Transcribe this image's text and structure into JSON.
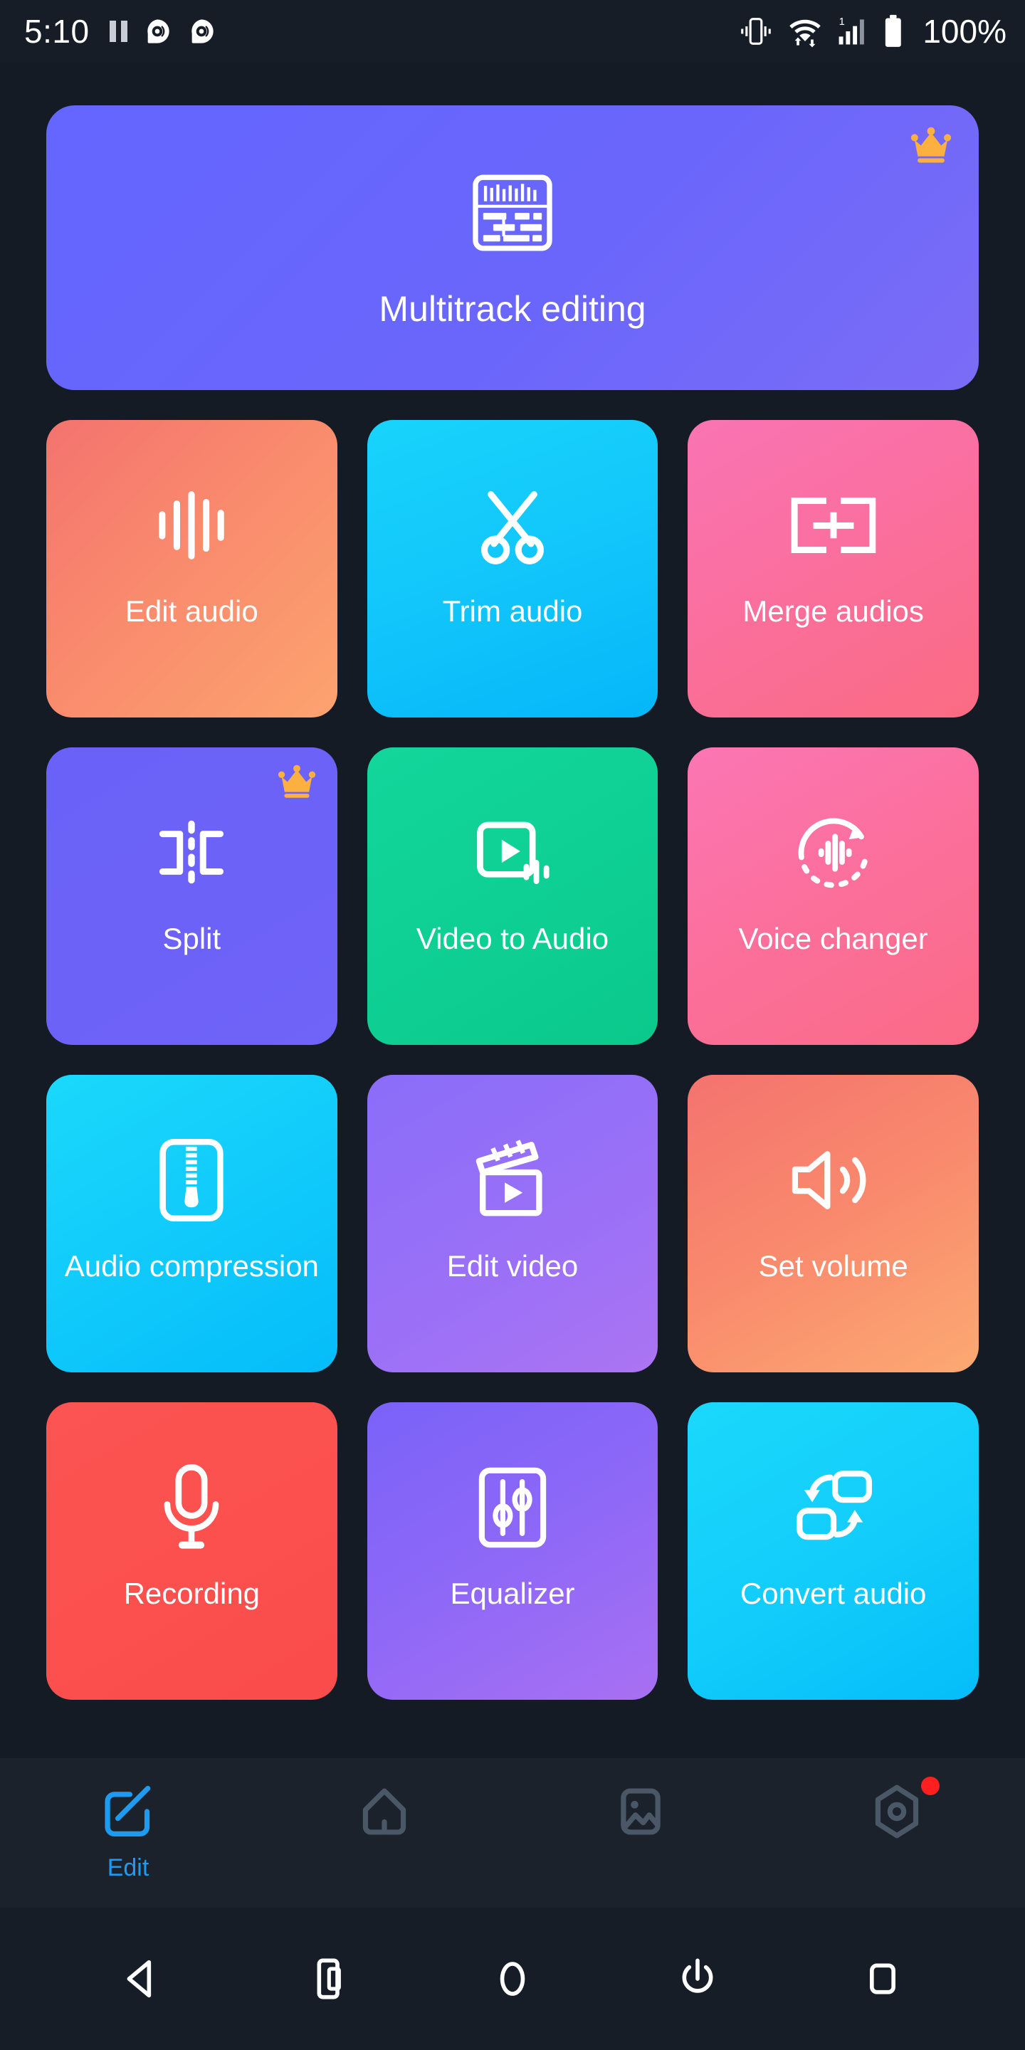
{
  "status_bar": {
    "time": "5:10",
    "battery_text": "100%",
    "signal_label": "1",
    "left_icons": [
      "pause-icon",
      "cast-audio-icon",
      "cast-audio-icon"
    ],
    "right_icons": [
      "vibrate-icon",
      "wifi-data-icon",
      "signal-bars-icon",
      "battery-icon"
    ]
  },
  "banner": {
    "label": "Multitrack editing",
    "icon": "multitrack-mixer-icon",
    "premium": true,
    "badge_icon": "crown-icon",
    "color": "#6366FF"
  },
  "tiles": [
    {
      "label": "Edit audio",
      "icon": "waveform-bars-icon",
      "premium": false,
      "color": "#f98a6d"
    },
    {
      "label": "Trim audio",
      "icon": "scissors-icon",
      "premium": false,
      "color": "#12c6fb"
    },
    {
      "label": "Merge audios",
      "icon": "merge-blocks-icon",
      "premium": false,
      "color": "#fa6f9f"
    },
    {
      "label": "Split",
      "icon": "split-brackets-icon",
      "premium": true,
      "color": "#6c62f8"
    },
    {
      "label": "Video to Audio",
      "icon": "video-audio-icon",
      "premium": false,
      "color": "#0fd094"
    },
    {
      "label": "Voice changer",
      "icon": "voice-changer-icon",
      "premium": false,
      "color": "#fb6f9b"
    },
    {
      "label": "Audio compression",
      "icon": "zipper-icon",
      "premium": false,
      "color": "#10c9fb"
    },
    {
      "label": "Edit video",
      "icon": "clapperboard-icon",
      "premium": false,
      "color": "#9a70f7"
    },
    {
      "label": "Set volume",
      "icon": "speaker-volume-icon",
      "premium": false,
      "color": "#f98a6d"
    },
    {
      "label": "Recording",
      "icon": "microphone-icon",
      "premium": false,
      "color": "#fb504e"
    },
    {
      "label": "Equalizer",
      "icon": "equalizer-sliders-icon",
      "premium": false,
      "color": "#8e68f7"
    },
    {
      "label": "Convert audio",
      "icon": "convert-swap-icon",
      "premium": false,
      "color": "#12ccfb"
    }
  ],
  "tab_bar": {
    "active_color": "#1e9bf0",
    "inactive_color": "#4a5767",
    "items": [
      {
        "label": "Edit",
        "icon": "edit-square-icon",
        "active": true,
        "badge": false
      },
      {
        "label": "",
        "icon": "home-icon",
        "active": false,
        "badge": false
      },
      {
        "label": "",
        "icon": "gallery-image-icon",
        "active": false,
        "badge": false
      },
      {
        "label": "",
        "icon": "settings-gear-icon",
        "active": false,
        "badge": true
      }
    ]
  },
  "nav_bar": {
    "items": [
      {
        "icon": "back-triangle-icon"
      },
      {
        "icon": "screenshot-icon"
      },
      {
        "icon": "home-circle-icon"
      },
      {
        "icon": "power-icon"
      },
      {
        "icon": "recents-square-icon"
      }
    ]
  }
}
